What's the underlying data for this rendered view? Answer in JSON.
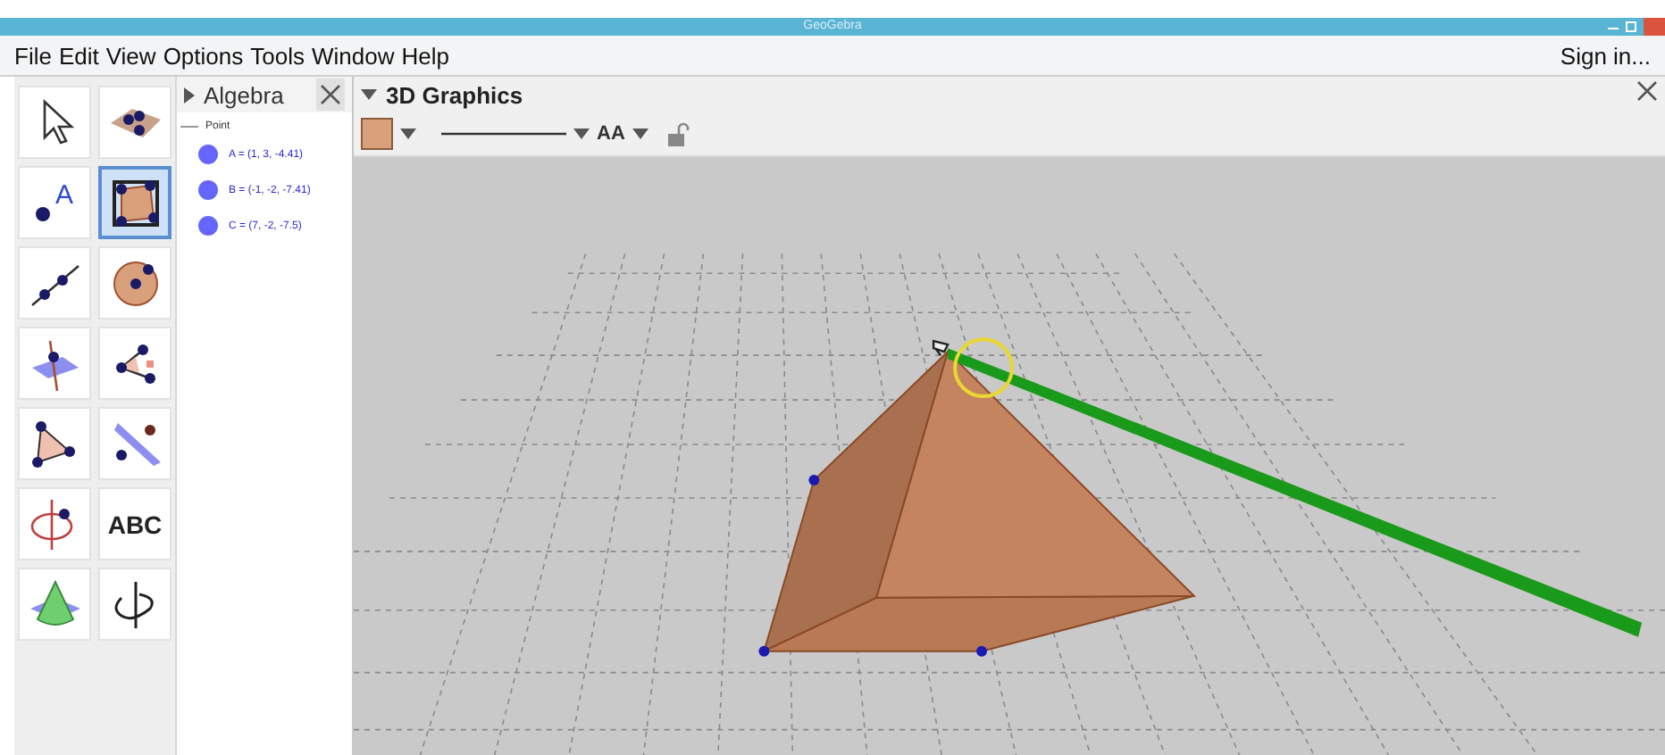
{
  "window": {
    "title": "GeoGebra"
  },
  "menu": [
    "File",
    "Edit",
    "View",
    "Options",
    "Tools",
    "Window",
    "Help"
  ],
  "sign_in": "Sign in...",
  "tools": [
    {
      "kind": "move",
      "selected": false
    },
    {
      "kind": "points-on-plane",
      "selected": false
    },
    {
      "kind": "point",
      "label": "A",
      "selected": false
    },
    {
      "kind": "pyramid",
      "selected": true
    },
    {
      "kind": "line",
      "selected": false
    },
    {
      "kind": "sphere",
      "selected": false
    },
    {
      "kind": "intersect",
      "selected": false
    },
    {
      "kind": "angle",
      "selected": false
    },
    {
      "kind": "polygon",
      "selected": false
    },
    {
      "kind": "parallel-plane",
      "selected": false
    },
    {
      "kind": "rotate",
      "selected": false
    },
    {
      "kind": "text",
      "label": "ABC",
      "selected": false
    },
    {
      "kind": "cone",
      "selected": false
    },
    {
      "kind": "rotate-view",
      "selected": false
    }
  ],
  "algebra": {
    "title": "Algebra",
    "groups": [
      {
        "name": "Point",
        "expanded": true,
        "children": [
          {
            "text": "A = (1, 3, -4.41)",
            "color": "#6666ff"
          },
          {
            "text": "B = (-1, -2, -7.41)",
            "color": "#6666ff"
          },
          {
            "text": "C = (7, -2, -7.5)",
            "color": "#6666ff"
          }
        ]
      }
    ]
  },
  "graphics": {
    "title": "3D Graphics",
    "style": {
      "color": "#d9a07c",
      "locked": false,
      "font_label": "AA"
    }
  }
}
